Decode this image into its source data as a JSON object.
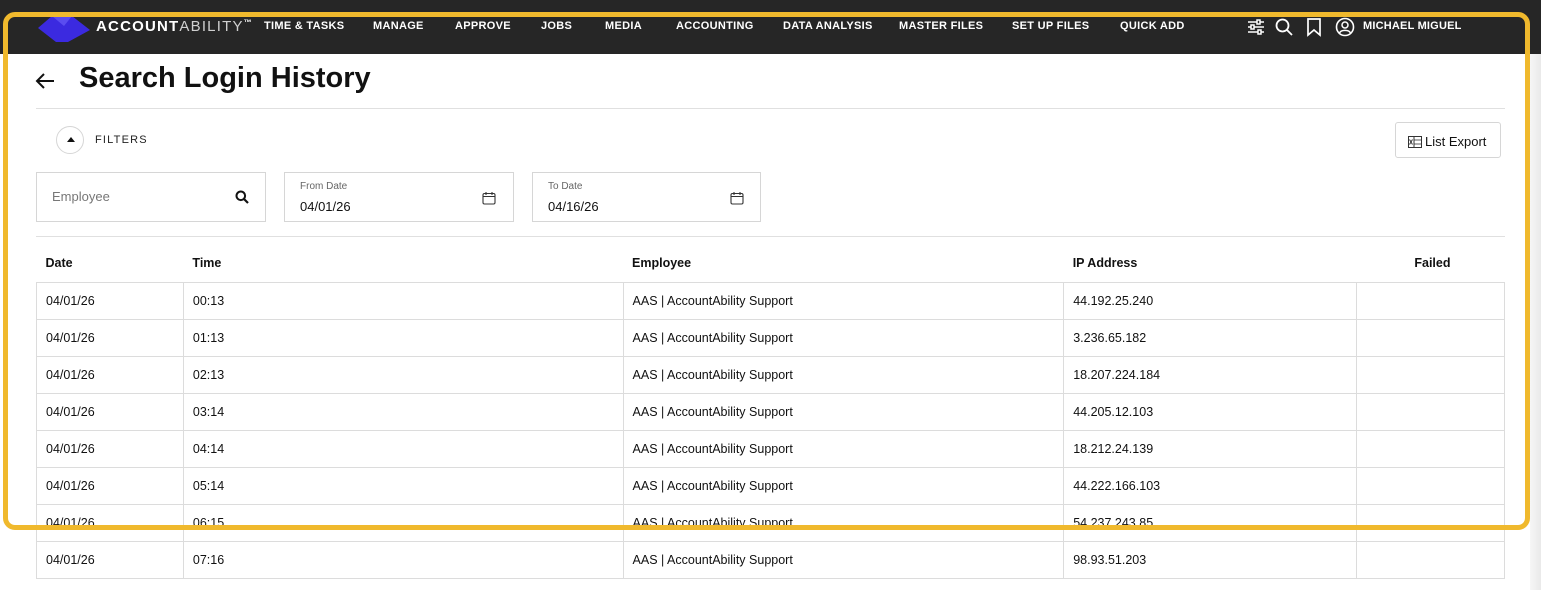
{
  "brand": {
    "name_bold": "ACCOUNT",
    "name_thin": "ABILITY",
    "trademark": "™",
    "mark_color": "#3b2ae0"
  },
  "nav": {
    "items": [
      "TIME & TASKS",
      "MANAGE",
      "APPROVE",
      "JOBS",
      "MEDIA",
      "ACCOUNTING",
      "DATA ANALYSIS",
      "MASTER FILES",
      "SET UP FILES",
      "QUICK ADD"
    ],
    "tools": [
      "sliders-icon",
      "search-icon",
      "bookmark-icon",
      "user-circle-icon"
    ],
    "user_name": "MICHAEL MIGUEL"
  },
  "page": {
    "title": "Search Login History"
  },
  "filters": {
    "label": "FILTERS",
    "employee_placeholder": "Employee",
    "from_date_label": "From Date",
    "from_date_value": "04/01/26",
    "to_date_label": "To Date",
    "to_date_value": "04/16/26"
  },
  "export": {
    "label": "List Export"
  },
  "table": {
    "headers": [
      "Date",
      "Time",
      "Employee",
      "IP Address",
      "Failed"
    ],
    "rows": [
      {
        "date": "04/01/26",
        "time": "00:13",
        "employee": "AAS | AccountAbility Support",
        "ip": "44.192.25.240",
        "failed": ""
      },
      {
        "date": "04/01/26",
        "time": "01:13",
        "employee": "AAS | AccountAbility Support",
        "ip": "3.236.65.182",
        "failed": ""
      },
      {
        "date": "04/01/26",
        "time": "02:13",
        "employee": "AAS | AccountAbility Support",
        "ip": "18.207.224.184",
        "failed": ""
      },
      {
        "date": "04/01/26",
        "time": "03:14",
        "employee": "AAS | AccountAbility Support",
        "ip": "44.205.12.103",
        "failed": ""
      },
      {
        "date": "04/01/26",
        "time": "04:14",
        "employee": "AAS | AccountAbility Support",
        "ip": "18.212.24.139",
        "failed": ""
      },
      {
        "date": "04/01/26",
        "time": "05:14",
        "employee": "AAS | AccountAbility Support",
        "ip": "44.222.166.103",
        "failed": ""
      },
      {
        "date": "04/01/26",
        "time": "06:15",
        "employee": "AAS | AccountAbility Support",
        "ip": "54.237.243.85",
        "failed": ""
      },
      {
        "date": "04/01/26",
        "time": "07:16",
        "employee": "AAS | AccountAbility Support",
        "ip": "98.93.51.203",
        "failed": ""
      }
    ]
  },
  "colors": {
    "navbar": "#262626",
    "highlight": "#f0b92d"
  }
}
